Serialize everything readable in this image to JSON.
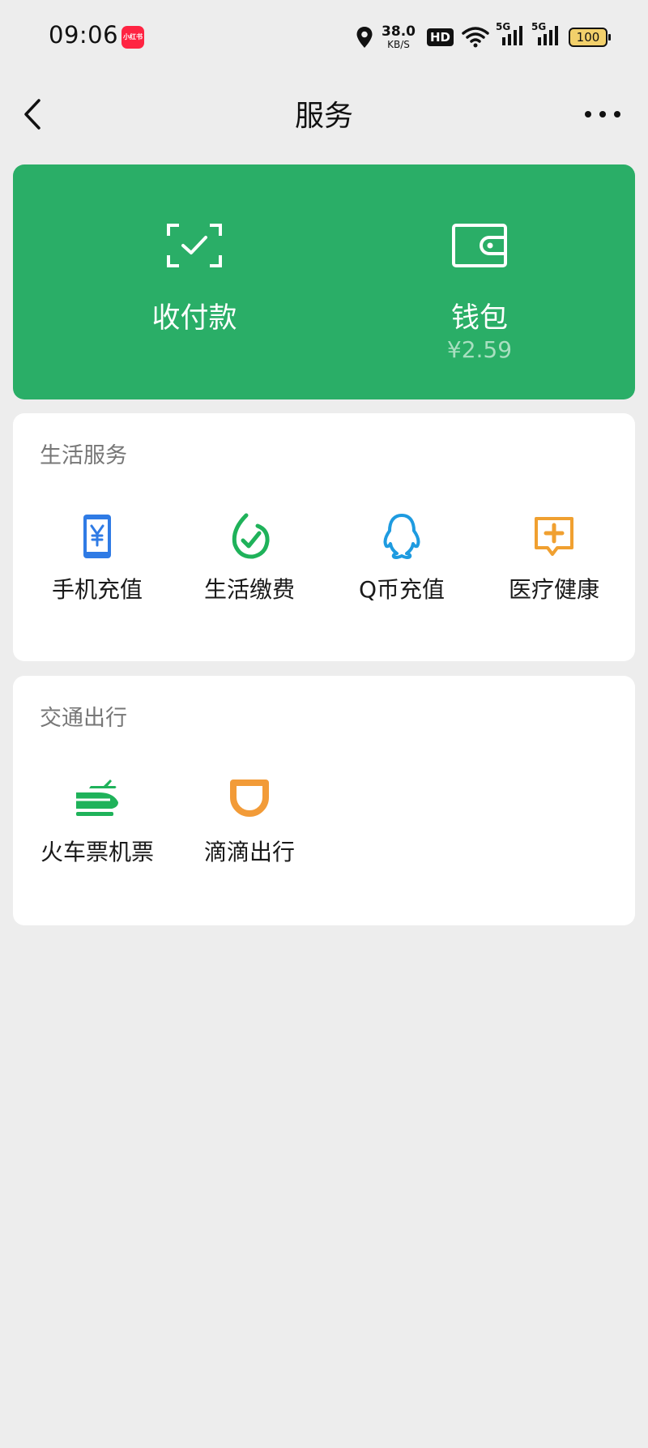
{
  "status_bar": {
    "time": "09:06",
    "app_badge": "小红书",
    "net_speed": "38.0",
    "net_unit": "KB/S",
    "hd_label": "HD",
    "signal_1": "5G",
    "signal_2": "5G",
    "battery": "100",
    "icons": [
      "location-icon",
      "wifi-icon",
      "signal-icon",
      "battery-icon"
    ]
  },
  "nav": {
    "title": "服务",
    "back_icon": "chevron-left-icon",
    "more_icon": "more-dots-icon"
  },
  "pay_card": {
    "color": "#2aae67",
    "items": [
      {
        "label": "收付款",
        "icon": "scan-check-icon"
      },
      {
        "label": "钱包",
        "sub": "¥2.59",
        "icon": "wallet-icon"
      }
    ]
  },
  "life_services": {
    "title": "生活服务",
    "items": [
      {
        "label": "手机充值",
        "icon": "phone-yuan-icon",
        "color": "#2f7be5"
      },
      {
        "label": "生活缴费",
        "icon": "leaf-check-icon",
        "color": "#1fb25a"
      },
      {
        "label": "Q币充值",
        "icon": "qq-penguin-icon",
        "color": "#1e9be0"
      },
      {
        "label": "医疗健康",
        "icon": "medical-chat-icon",
        "color": "#f0a030"
      }
    ]
  },
  "transport": {
    "title": "交通出行",
    "items": [
      {
        "label": "火车票机票",
        "icon": "train-plane-icon",
        "color": "#1fb25a"
      },
      {
        "label": "滴滴出行",
        "icon": "didi-icon",
        "color": "#f29b38"
      }
    ]
  }
}
